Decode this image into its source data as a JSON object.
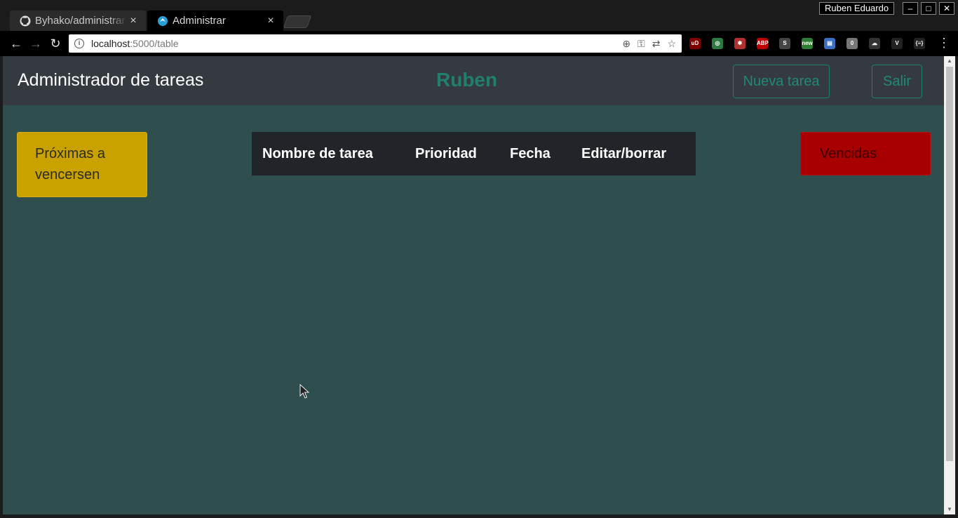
{
  "browser": {
    "tabs": [
      {
        "title": "Byhako/administrar",
        "active": false,
        "favicon": "github-icon"
      },
      {
        "title": "Administrar",
        "active": true,
        "favicon": "app-icon"
      }
    ],
    "close_glyph": "×",
    "profile_name": "Ruben Eduardo",
    "window_controls": {
      "minimize": "–",
      "maximize": "□",
      "close": "✕"
    },
    "url_host": "localhost",
    "url_rest": ":5000/table",
    "nav": {
      "back": "←",
      "forward": "→",
      "reload": "↻"
    },
    "omnibox_icons": [
      "zoom-icon",
      "key-icon",
      "translate-icon",
      "star-icon"
    ],
    "extensions": [
      {
        "name": "ublock-icon",
        "color": "#800000",
        "label": "uD"
      },
      {
        "name": "target-icon",
        "color": "#2c7a3f",
        "label": "◎"
      },
      {
        "name": "bug-icon",
        "color": "#b03030",
        "label": "✱"
      },
      {
        "name": "abp-icon",
        "color": "#c00000",
        "label": "ABP"
      },
      {
        "name": "skype-icon",
        "color": "#444444",
        "label": "S"
      },
      {
        "name": "screencast-icon",
        "color": "#2e7d32",
        "label": "new"
      },
      {
        "name": "book-icon",
        "color": "#3a6fc4",
        "label": "▤"
      },
      {
        "name": "zero-icon",
        "color": "#777777",
        "label": "0"
      },
      {
        "name": "cloud-icon",
        "color": "#333333",
        "label": "☁"
      },
      {
        "name": "vue-icon",
        "color": "#222222",
        "label": "V"
      },
      {
        "name": "json-icon",
        "color": "#222222",
        "label": "{≡}"
      }
    ]
  },
  "navbar": {
    "brand": "Administrador de tareas",
    "user": "Ruben",
    "new_task_label": "Nueva tarea",
    "logout_label": "Salir"
  },
  "cards": {
    "upcoming": "Próximas a vencersen",
    "expired": "Vencidas"
  },
  "table": {
    "headers": [
      "Nombre de tarea",
      "Prioridad",
      "Fecha",
      "Editar/borrar"
    ]
  },
  "colors": {
    "page_bg": "#2f4f4f",
    "navbar_bg": "#343a40",
    "accent": "#20806b",
    "upcoming": "#c9a200",
    "expired": "#a80000",
    "table_header": "#212529"
  }
}
